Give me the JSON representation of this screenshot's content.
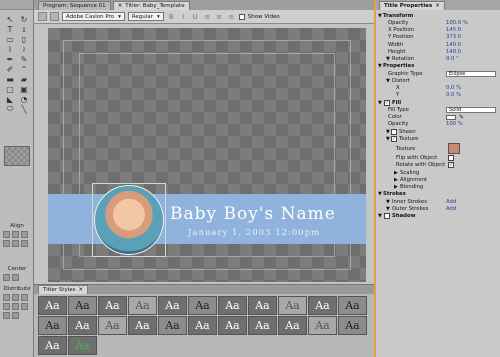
{
  "tools": {
    "align_label": "Align",
    "center_label": "Center",
    "distribute_label": "Distribute"
  },
  "designer": {
    "tabs": [
      {
        "label": "Program: Sequence 01"
      },
      {
        "label": "Titler: Baby_Template"
      }
    ],
    "font_family": "Adobe Caslon Pro",
    "font_style": "Regular",
    "show_video_label": "Show Video",
    "title_text": "Baby Boy's Name",
    "date_text": "January 1, 2003 12:00pm"
  },
  "styles_panel": {
    "tab_label": "Titler Styles",
    "swatches": [
      "Aa",
      "Aa",
      "Aa",
      "Aa",
      "Aa",
      "Aa",
      "Aa",
      "Aa",
      "Aa",
      "Aa",
      "Aa",
      "Aa",
      "Aa",
      "Aa",
      "Aa",
      "Aa",
      "Aa",
      "Aa",
      "Aa",
      "Aa",
      "Aa",
      "Aa",
      "Aa",
      "Aa"
    ]
  },
  "properties": {
    "tab_label": "Title Properties",
    "rows": [
      {
        "type": "sec",
        "key": "Transform"
      },
      {
        "type": "row",
        "key": "Opacity",
        "value": "100.0 %"
      },
      {
        "type": "row",
        "key": "X Position",
        "value": "145.0"
      },
      {
        "type": "row",
        "key": "Y Position",
        "value": "373.0"
      },
      {
        "type": "row",
        "key": "Width",
        "value": "140.0"
      },
      {
        "type": "row",
        "key": "Height",
        "value": "140.0"
      },
      {
        "type": "sub",
        "key": "Rotation",
        "value": "0.0 °"
      },
      {
        "type": "sec",
        "key": "Properties"
      },
      {
        "type": "row",
        "key": "Graphic Type",
        "dropdown": "Ellipse"
      },
      {
        "type": "sub",
        "key": "Distort"
      },
      {
        "type": "sub2",
        "key": "X",
        "value": "0.0 %"
      },
      {
        "type": "sub2",
        "key": "Y",
        "value": "0.0 %"
      },
      {
        "type": "sec",
        "key": "Fill"
      },
      {
        "type": "row",
        "key": "Fill Type",
        "dropdown": "Solid"
      },
      {
        "type": "row",
        "key": "Color",
        "color": "#ffffff"
      },
      {
        "type": "row",
        "key": "Opacity",
        "value": "100 %"
      },
      {
        "type": "sub",
        "key": "Sheen"
      },
      {
        "type": "sub",
        "key": "Texture"
      },
      {
        "type": "sub2",
        "key": "Texture",
        "texture": true
      },
      {
        "type": "sub2",
        "key": "Flip with Object",
        "checkbox": false
      },
      {
        "type": "sub2",
        "key": "Rotate with Object",
        "checkbox": true
      },
      {
        "type": "sub3",
        "key": "Scaling"
      },
      {
        "type": "sub3",
        "key": "Alignment"
      },
      {
        "type": "sub3",
        "key": "Blending"
      },
      {
        "type": "sec",
        "key": "Strokes"
      },
      {
        "type": "sub",
        "key": "Inner Strokes",
        "link": "Add"
      },
      {
        "type": "sub",
        "key": "Outer Strokes",
        "link": "Add"
      },
      {
        "type": "sec",
        "key": "Shadow"
      }
    ]
  }
}
